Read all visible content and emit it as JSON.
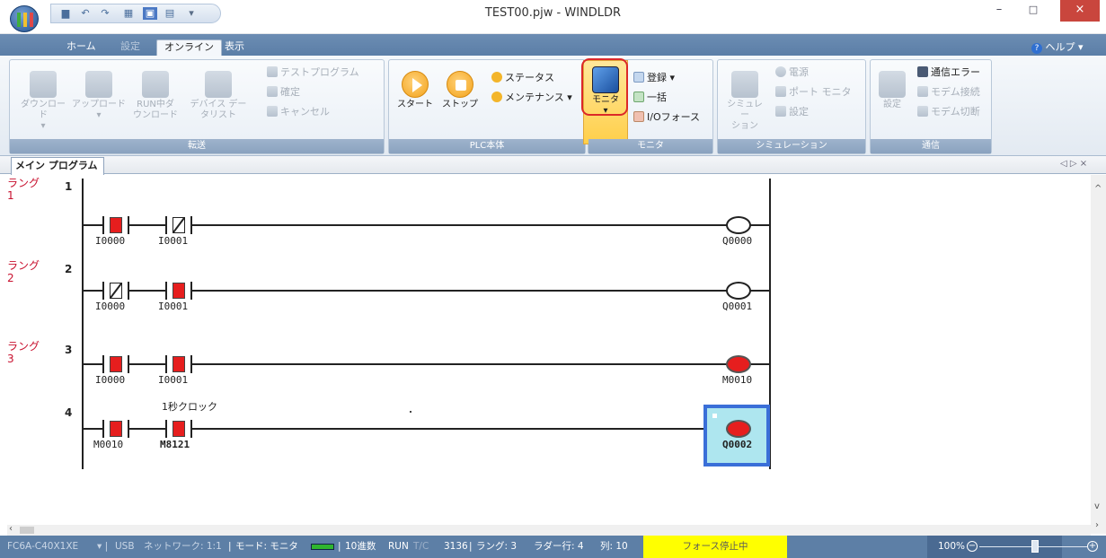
{
  "window": {
    "title": "TEST00.pjw - WINDLDR",
    "minimize": "–",
    "maximize": "□",
    "close": "×"
  },
  "ribbon_tabs": [
    {
      "label": "ホーム"
    },
    {
      "label": "設定"
    },
    {
      "label": "オンライン"
    },
    {
      "label": "表示"
    }
  ],
  "help": {
    "label": "ヘルプ"
  },
  "groups": {
    "transfer": {
      "label": "転送",
      "download": "ダウンロード",
      "upload": "アップロード",
      "runtime_line1": "RUN中ダ",
      "runtime_line2": "ウンロード",
      "devlist_line1": "デバイス デー",
      "devlist_line2": "タリスト",
      "test_program": "テストプログラム",
      "confirm": "確定",
      "cancel": "キャンセル"
    },
    "plc": {
      "label": "PLC本体",
      "start": "スタート",
      "stop": "ストップ",
      "status": "ステータス",
      "maintenance": "メンテナンス"
    },
    "monitor": {
      "label": "モニタ",
      "monitor": "モニタ",
      "register": "登録",
      "batch": "一括",
      "io_force": "I/Oフォース"
    },
    "simulation": {
      "label": "シミュレーション",
      "simulation_line1": "シミュレー",
      "simulation_line2": "ション",
      "power": "電源",
      "port_monitor": "ポート モニタ",
      "settings": "設定"
    },
    "comm": {
      "label": "通信",
      "settings": "設定",
      "comm_error": "通信エラー",
      "modem_connect": "モデム接続",
      "modem_switch": "モデム切断"
    }
  },
  "document_tab": {
    "label": "メイン プログラム",
    "nav": "◁ ▷ ×"
  },
  "ladder": {
    "rung_label": "ラング",
    "rungs": [
      {
        "number": "1",
        "label_index": "1",
        "contacts": [
          {
            "addr": "I0000",
            "state": "on-no"
          },
          {
            "addr": "I0001",
            "state": "off-nc"
          }
        ],
        "coil": {
          "addr": "Q0000",
          "on": false
        }
      },
      {
        "number": "2",
        "label_index": "2",
        "contacts": [
          {
            "addr": "I0000",
            "state": "off-nc"
          },
          {
            "addr": "I0001",
            "state": "on-no"
          }
        ],
        "coil": {
          "addr": "Q0001",
          "on": false
        }
      },
      {
        "number": "3",
        "label_index": "3",
        "contacts": [
          {
            "addr": "I0000",
            "state": "on-no"
          },
          {
            "addr": "I0001",
            "state": "on-no"
          }
        ],
        "coil": {
          "addr": "M0010",
          "on": true
        }
      },
      {
        "number": "4",
        "label_index": "",
        "comment": "1秒クロック",
        "contacts": [
          {
            "addr": "M0010",
            "state": "on-no"
          },
          {
            "addr": "M8121",
            "state": "on-no"
          }
        ],
        "coil": {
          "addr": "Q0002",
          "on": true
        }
      }
    ]
  },
  "status": {
    "plc_model": "FC6A-C40X1XE",
    "port": "USB",
    "network": "ネットワーク: 1:1",
    "mode": "モード: モニタ",
    "radix": "10進数",
    "run": "RUN",
    "tc": "T/C",
    "scan": "3136",
    "rung": "ラング: 3",
    "ladder_row": "ラダー行: 4",
    "column": "列: 10",
    "force": "フォース停止中",
    "zoom": "100%"
  },
  "colors": {
    "accent": "#5d7fa6",
    "energized": "#e61e1e",
    "force_bg": "#ffff00",
    "highlight": "#dc2828"
  }
}
